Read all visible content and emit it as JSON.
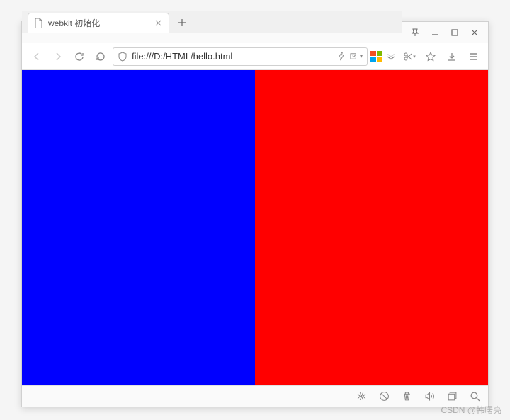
{
  "tab": {
    "title": "webkit 初始化"
  },
  "address": {
    "url": "file:///D:/HTML/hello.html"
  },
  "page": {
    "leftColor": "#0000ff",
    "rightColor": "#ff0000"
  },
  "watermark": "CSDN @韩曙亮"
}
